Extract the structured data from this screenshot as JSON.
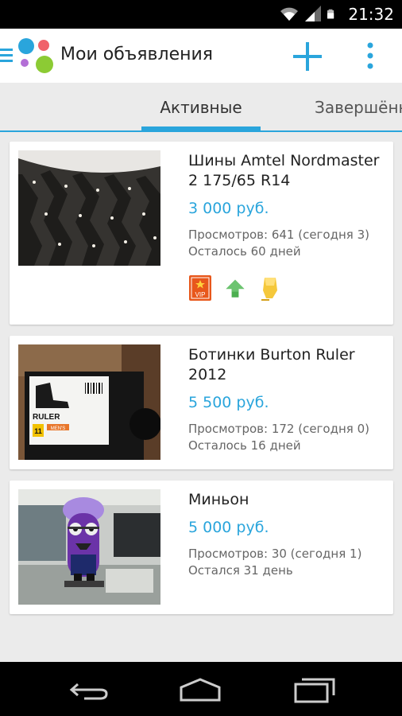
{
  "status_bar": {
    "time": "21:32",
    "icons": [
      "wifi-icon",
      "signal-icon",
      "battery-icon"
    ]
  },
  "app_bar": {
    "title": "Мои объявления",
    "icons": [
      "nav-drawer-icon",
      "app-logo",
      "plus-icon",
      "more-vert-icon"
    ]
  },
  "tabs": [
    {
      "label": "Активные",
      "active": true
    },
    {
      "label": "Завершённые",
      "active": false
    }
  ],
  "colors": {
    "accent": "#2aa5dc",
    "vip": "#e8571b",
    "up_arrow": "#4caf50",
    "highlight": "#f5c83b"
  },
  "listings": [
    {
      "title": "Шины Amtel Nordmaster 2 175/65 R14",
      "price": "3 000 руб.",
      "views": "Просмотров: 641 (сегодня 3)",
      "remaining": "Осталось 60 дней",
      "image": "studded-tire-photo",
      "badges": [
        {
          "icon": "vip-badge-icon",
          "label": "VIP"
        },
        {
          "icon": "up-arrow-icon"
        },
        {
          "icon": "highlighter-icon"
        }
      ]
    },
    {
      "title": "Ботинки Burton Ruler 2012",
      "price": "5 500 руб.",
      "views": "Просмотров: 172 (сегодня 0)",
      "remaining": "Осталось 16 дней",
      "image": "boot-box-photo",
      "image_text": {
        "brand": "RULER",
        "size": "11",
        "tag": "MEN'S"
      }
    },
    {
      "title": "Миньон",
      "price": "5 000 руб.",
      "views": "Просмотров: 30 (сегодня 1)",
      "remaining": "Остался 31 день",
      "image": "purple-minion-photo"
    }
  ],
  "nav_bar": {
    "icons": [
      "back-icon",
      "home-icon",
      "recents-icon"
    ]
  }
}
